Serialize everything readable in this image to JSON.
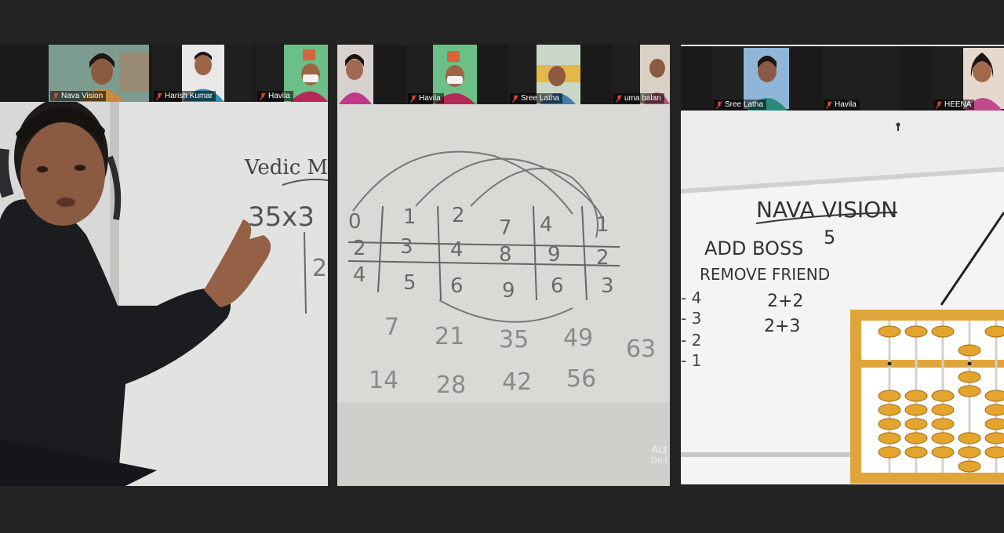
{
  "panels": [
    {
      "participants": [
        {
          "name": "Nava Vision",
          "muted": true
        },
        {
          "name": "Harish Kumar",
          "muted": true
        },
        {
          "name": "Havila",
          "muted": true
        }
      ],
      "board_text": {
        "heading": "Vedic M",
        "expression": "35x3",
        "digit": "2"
      }
    },
    {
      "participants": [
        {
          "name": "",
          "muted": false
        },
        {
          "name": "Havila",
          "muted": true
        },
        {
          "name": "Sree Latha",
          "muted": true
        },
        {
          "name": "uma balan",
          "muted": true
        }
      ],
      "grid_rows": [
        [
          "0",
          "1",
          "2",
          "7",
          "4",
          "1"
        ],
        [
          "2",
          "3",
          "4",
          "8",
          "9",
          "2"
        ],
        [
          "4",
          "5",
          "6",
          "9",
          "6",
          "3"
        ]
      ],
      "multiples_row1": [
        "7",
        "21",
        "35",
        "49",
        "63"
      ],
      "multiples_row2": [
        "14",
        "28",
        "42",
        "56"
      ],
      "watermark": {
        "line1": "Act",
        "line2": "Go t"
      }
    },
    {
      "participants": [
        {
          "name": "Sree Latha",
          "muted": true
        },
        {
          "name": "Havila",
          "muted": true
        },
        {
          "name": "HEENA",
          "muted": true
        }
      ],
      "board_text": {
        "title": "NAVA VISION",
        "line1": "ADD BOSS",
        "number": "5",
        "line2": "REMOVE FRIEND",
        "left_list": [
          "- 4",
          "- 3",
          "- 2",
          "- 1"
        ],
        "sum1": "2+2",
        "sum2": "2+3"
      }
    }
  ]
}
